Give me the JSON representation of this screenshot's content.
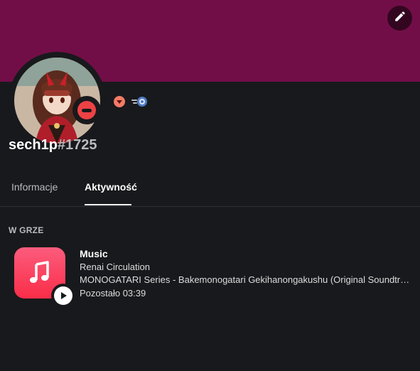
{
  "banner": {
    "color": "#720e47"
  },
  "profile": {
    "username": "sech1p",
    "discriminator": "#1725",
    "status": "do-not-disturb",
    "status_color": "#ed4245",
    "badges": [
      "hypesquad-brilliance-badge",
      "nitro-boost-badge"
    ]
  },
  "tabs": [
    {
      "label": "Informacje",
      "active": false
    },
    {
      "label": "Aktywność",
      "active": true
    }
  ],
  "activity": {
    "section_header": "W GRZE",
    "app_name": "Music",
    "details": "Renai Circulation",
    "state": "MONOGATARI Series - Bakemonogatari Gekihanongakushu (Original Soundtrack)",
    "time_left": "Pozostało 03:39",
    "icon": "apple-music-icon"
  },
  "actions": {
    "edit_icon": "pencil-icon"
  }
}
